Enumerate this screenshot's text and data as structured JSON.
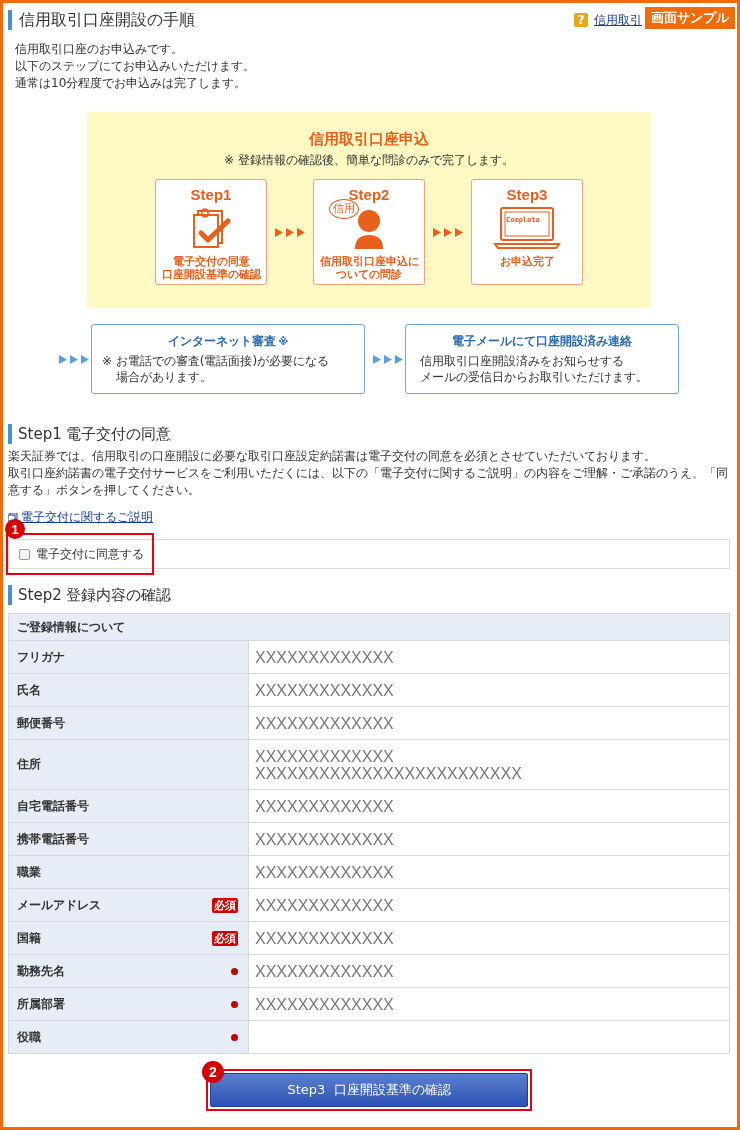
{
  "header": {
    "title": "信用取引口座開設の手順",
    "help_icon": "?",
    "help_link": "信用取引",
    "sample_label": "画面サンプル",
    "intro": [
      "信用取引口座のお申込みです。",
      "以下のステップにてお申込みいただけます。",
      "通常は10分程度でお申込みは完了します。"
    ]
  },
  "flow": {
    "title": "信用取引口座申込",
    "note": "※ 登録情報の確認後、簡単な問診のみで完了します。",
    "steps": [
      {
        "label": "Step1",
        "caption": [
          "電子交付の同意",
          "口座開設基準の確認"
        ]
      },
      {
        "label": "Step2",
        "bubble": "信用",
        "caption": [
          "信用取引口座申込に",
          "ついての問診"
        ]
      },
      {
        "label": "Step3",
        "screen_text": "Complata",
        "caption": [
          "お申込完了"
        ]
      }
    ],
    "after": [
      {
        "title": "インターネット審査",
        "title_mark": "※",
        "lines": [
          "※ お電話での審査(電話面接)が必要になる",
          "場合があります。"
        ]
      },
      {
        "title": "電子メールにて口座開設済み連絡",
        "lines": [
          "信用取引口座開設済みをお知らせする",
          "メールの受信日からお取引いただけます。"
        ]
      }
    ]
  },
  "step1": {
    "title": "Step1 電子交付の同意",
    "paragraphs": [
      "楽天証券では、信用取引の口座開設に必要な取引口座設定約諾書は電子交付の同意を必須とさせていただいております。",
      "取引口座約諾書の電子交付サービスをご利用いただくには、以下の「電子交付に関するご説明」の内容をご理解・ご承諾のうえ、「同意する」ボタンを押してください。"
    ],
    "link": "電子交付に関するご説明",
    "consent": {
      "label": "電子交付に同意する",
      "checked": false,
      "badge": "1"
    }
  },
  "step2": {
    "title": "Step2 登録内容の確認",
    "caption": "ご登録情報について",
    "rows": [
      {
        "label": "フリガナ",
        "kind": "plain",
        "values": [
          "XXXXXXXXXXXXX"
        ]
      },
      {
        "label": "氏名",
        "kind": "plain",
        "values": [
          "XXXXXXXXXXXXX"
        ]
      },
      {
        "label": "郵便番号",
        "kind": "plain",
        "values": [
          "XXXXXXXXXXXXX"
        ]
      },
      {
        "label": "住所",
        "kind": "plain",
        "values": [
          "XXXXXXXXXXXXX",
          "XXXXXXXXXXXXXXXXXXXXXXXXX"
        ]
      },
      {
        "label": "自宅電話番号",
        "kind": "plain",
        "values": [
          "XXXXXXXXXXXXX"
        ]
      },
      {
        "label": "携帯電話番号",
        "kind": "plain",
        "values": [
          "XXXXXXXXXXXXX"
        ]
      },
      {
        "label": "職業",
        "kind": "plain",
        "values": [
          "XXXXXXXXXXXXX"
        ]
      },
      {
        "label": "メールアドレス",
        "kind": "required",
        "badge": "必須",
        "values": [
          "XXXXXXXXXXXXX"
        ]
      },
      {
        "label": "国籍",
        "kind": "required",
        "badge": "必須",
        "values": [
          "XXXXXXXXXXXXX"
        ]
      },
      {
        "label": "勤務先名",
        "kind": "dot",
        "values": [
          "XXXXXXXXXXXXX"
        ]
      },
      {
        "label": "所属部署",
        "kind": "dot",
        "values": [
          "XXXXXXXXXXXXX"
        ]
      },
      {
        "label": "役職",
        "kind": "dot",
        "values": []
      }
    ]
  },
  "submit": {
    "label": "Step3  口座開設基準の確認",
    "badge": "2"
  }
}
